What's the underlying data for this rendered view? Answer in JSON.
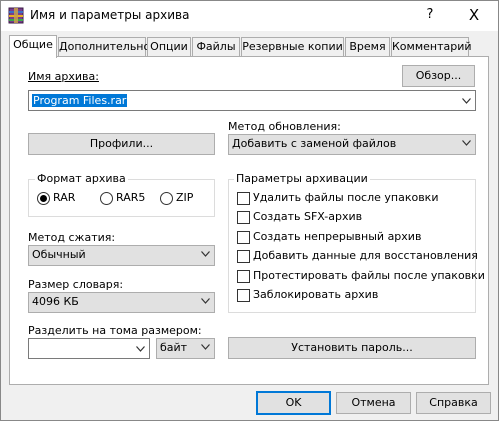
{
  "window": {
    "title": "Имя и параметры архива",
    "help_label": "?",
    "close_label": "X"
  },
  "tabs": [
    {
      "label": "Общие",
      "active": true
    },
    {
      "label": "Дополнительно"
    },
    {
      "label": "Опции"
    },
    {
      "label": "Файлы"
    },
    {
      "label": "Резервные копии"
    },
    {
      "label": "Время"
    },
    {
      "label": "Комментарий"
    }
  ],
  "general": {
    "archive_name_label": "Имя архива:",
    "browse_button": "Обзор...",
    "archive_name_value": "Program Files.rar",
    "profiles_button": "Профили...",
    "update_method_label": "Метод обновления:",
    "update_method_value": "Добавить с заменой файлов",
    "format_group_title": "Формат архива",
    "formats": [
      {
        "label": "RAR",
        "selected": true
      },
      {
        "label": "RAR5",
        "selected": false
      },
      {
        "label": "ZIP",
        "selected": false
      }
    ],
    "compression_label": "Метод сжатия:",
    "compression_value": "Обычный",
    "dictionary_label": "Размер словаря:",
    "dictionary_value": "4096 КБ",
    "split_label": "Разделить на тома размером:",
    "split_value": "",
    "split_unit_value": "байт",
    "options_group_title": "Параметры архивации",
    "options": [
      {
        "label": "Удалить файлы после упаковки",
        "checked": false
      },
      {
        "label": "Создать SFX-архив",
        "checked": false
      },
      {
        "label": "Создать непрерывный архив",
        "checked": false
      },
      {
        "label": "Добавить данные для восстановления",
        "checked": false
      },
      {
        "label": "Протестировать файлы после упаковки",
        "checked": false
      },
      {
        "label": "Заблокировать архив",
        "checked": false
      }
    ],
    "set_password_button": "Установить пароль..."
  },
  "footer": {
    "ok_button": "OK",
    "cancel_button": "Отмена",
    "help_button": "Справка"
  },
  "colors": {
    "accent": "#0078d7",
    "selection": "#0078d7",
    "background": "#f0f0f0"
  }
}
